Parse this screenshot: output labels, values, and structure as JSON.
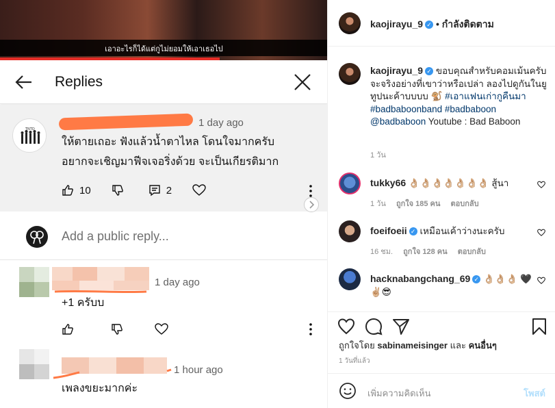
{
  "video": {
    "subtitle": "เอาอะไรก็ได้แต่กูไม่ยอมให้เอาเธอไป",
    "progress": 0.67
  },
  "yt": {
    "header_title": "Replies",
    "op": {
      "time": "1 day ago",
      "text_line1": "ให้ตายเถอะ ฟังแล้วน้ำตาไหล โดนใจมากครับ",
      "text_line2": "อยากจะเชิญมาฟีจเจอริ่งด้วย จะเป็นเกียรติมาก",
      "likes": "10",
      "replies": "2"
    },
    "reply_placeholder": "Add a public reply...",
    "replies": [
      {
        "time": "1 day ago",
        "text": "+1 ครับบ"
      },
      {
        "time": "1 hour ago",
        "text": "เพลงขยะมากค่ะ"
      }
    ]
  },
  "ig": {
    "author": "kaojirayu_9",
    "follow_status": "• กำลังติดตาม",
    "caption": {
      "text": "ขอบคุณสำหรับคอมเม้นครับ จะจริงอย่างที่เขาว่าหรือเปล่า ลองไปดูกันในยูทูปนะค้าบบบบ 🐒",
      "tag1": "#เอาแฟนเก่ากูคืนมา",
      "tag2": "#badbaboonband",
      "tag3": "#badbaboon",
      "mention": "@badbaboon",
      "tail": "Youtube : Bad Baboon",
      "age": "1 วัน"
    },
    "comments": [
      {
        "user": "tukky66",
        "verified": false,
        "text": "👌🏼👌🏼👌🏼👌🏼👌🏼👌🏼👌🏼 สู้นา",
        "time": "1 วัน",
        "likes": "ถูกใจ 185 คน",
        "reply": "ตอบกลับ"
      },
      {
        "user": "foeifoeii",
        "verified": true,
        "text": "เหมือนเค้าว่างนะครับ",
        "time": "16 ชม.",
        "likes": "ถูกใจ 128 คน",
        "reply": "ตอบกลับ"
      },
      {
        "user": "hacknabangchang_69",
        "verified": true,
        "text": "👌🏼👌🏼👌🏼 🖤✌🏼😎",
        "time": "",
        "likes": "",
        "reply": ""
      }
    ],
    "liked_by_prefix": "ถูกใจโดย",
    "liked_by_user": "sabinameisinger",
    "liked_by_and": "และ",
    "liked_by_others": "คนอื่นๆ",
    "post_age": "1 วันที่แล้ว",
    "comment_placeholder": "เพิ่มความคิดเห็น",
    "post_label": "โพสต์",
    "colors": {
      "accent": "#3897f0",
      "post_disabled": "#b2dffc",
      "yt_progress": "#e52d27",
      "redact": "#ff7a45"
    }
  }
}
